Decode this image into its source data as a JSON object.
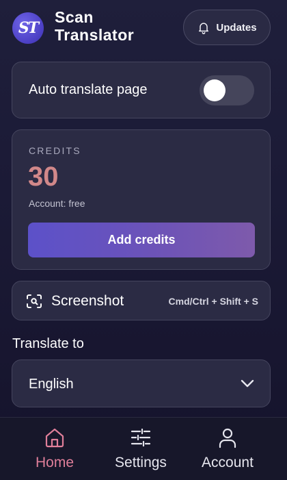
{
  "app": {
    "logo_text": "ST",
    "brand_line1": "Scan",
    "brand_line2": "Translator"
  },
  "header": {
    "updates_label": "Updates",
    "updates_icon": "bell-icon"
  },
  "auto_translate": {
    "label": "Auto translate page",
    "enabled": false
  },
  "credits": {
    "label": "CREDITS",
    "value": "30",
    "account_text": "Account: free",
    "add_button_label": "Add credits"
  },
  "screenshot": {
    "label": "Screenshot",
    "shortcut": "Cmd/Ctrl + Shift + S",
    "icon": "screenshot-icon"
  },
  "translate_to": {
    "label": "Translate to",
    "selected": "English"
  },
  "nav": {
    "items": [
      {
        "label": "Home",
        "icon": "home-icon",
        "active": true
      },
      {
        "label": "Settings",
        "icon": "sliders-icon",
        "active": false
      },
      {
        "label": "Account",
        "icon": "user-icon",
        "active": false
      }
    ]
  },
  "colors": {
    "background": "#1b1a36",
    "card": "#2b2b44",
    "accent_pink": "#e07f9a",
    "credits_value": "#d1888a",
    "button_gradient_start": "#5c51c9",
    "button_gradient_end": "#7e5aab"
  }
}
